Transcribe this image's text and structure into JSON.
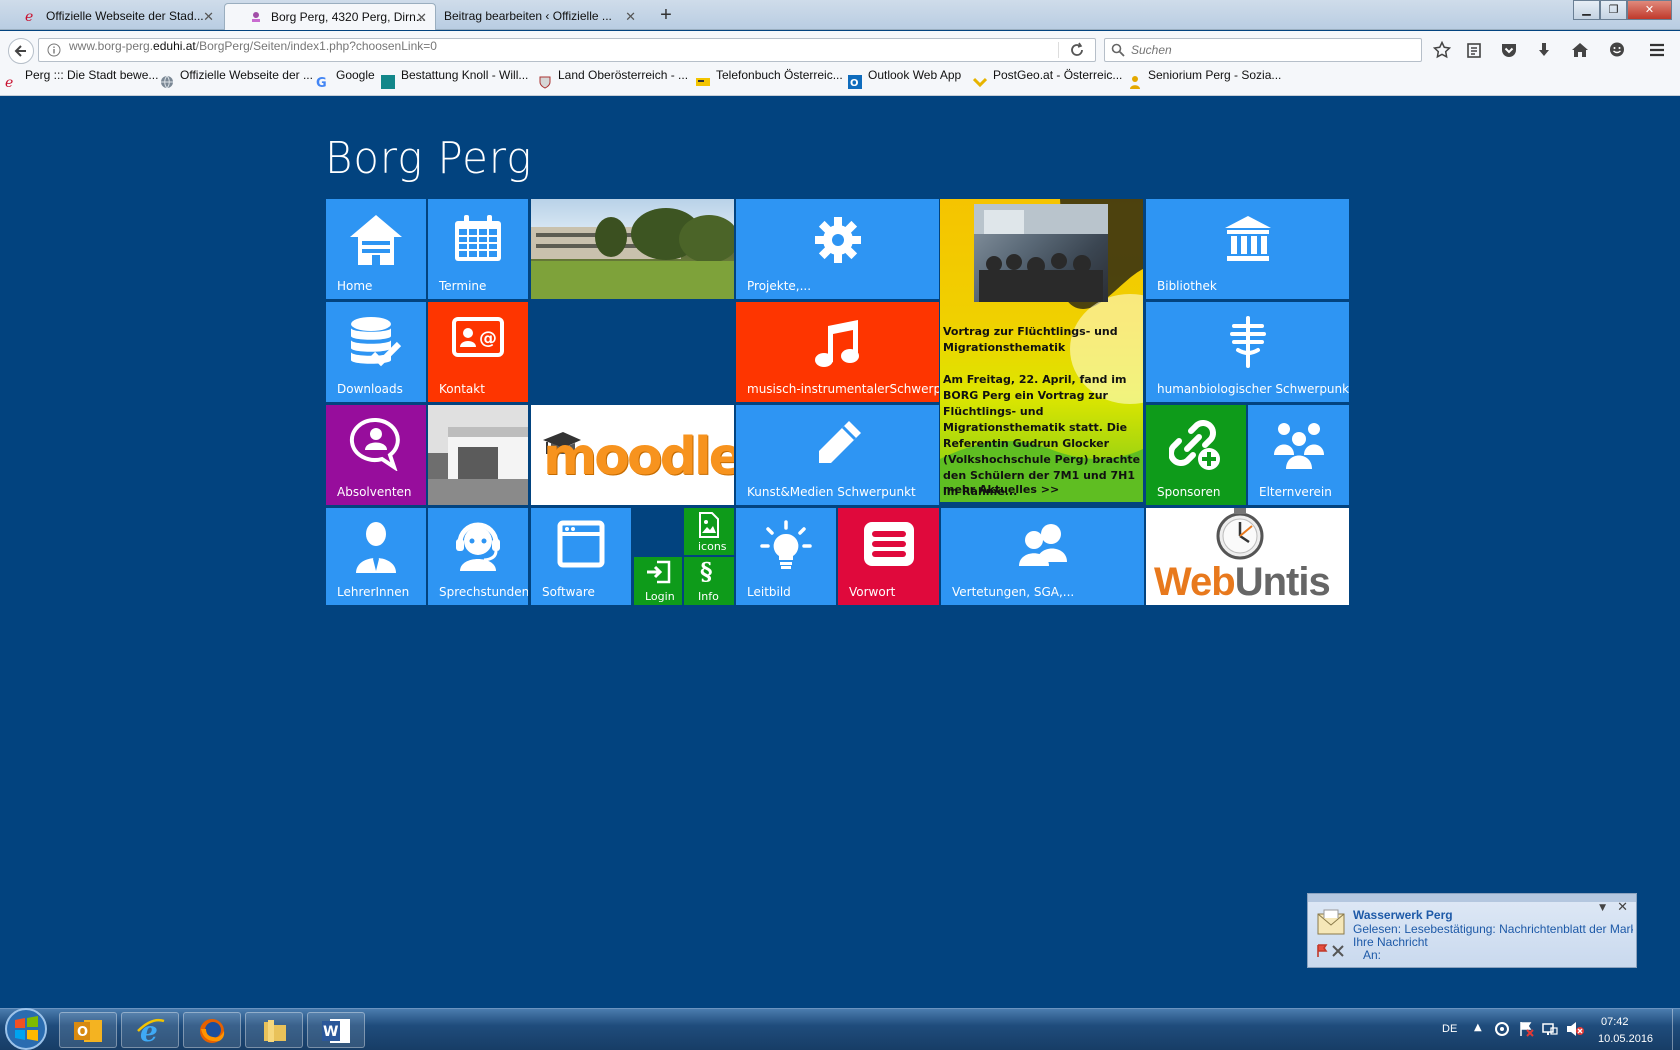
{
  "browser": {
    "tabs": [
      {
        "label": "Offizielle Webseite der Stad...",
        "active": false
      },
      {
        "label": "Borg Perg, 4320 Perg, Dirn...",
        "active": true
      },
      {
        "label": "Beitrag bearbeiten ‹ Offizielle ...",
        "active": false
      }
    ],
    "url_prefix": "www.borg-perg.",
    "url_domain": "eduhi.at",
    "url_path": "/BorgPerg/Seiten/index1.php?choosenLink=0",
    "search_placeholder": "Suchen",
    "bookmarks": [
      "Perg ::: Die Stadt bewe...",
      "Offizielle Webseite der ...",
      "Google",
      "Bestattung Knoll - Will...",
      "Land Oberösterreich - ...",
      "Telefonbuch Österreic...",
      "Outlook Web App",
      "PostGeo.at - Österreic...",
      "Seniorium Perg - Sozia..."
    ]
  },
  "site": {
    "title": "Borg Perg",
    "tiles": {
      "home": "Home",
      "termine": "Termine",
      "projekte": "Projekte,...",
      "bibliothek": "Bibliothek",
      "downloads": "Downloads",
      "kontakt": "Kontakt",
      "musik": "musisch-instrumentalerSchwerpunkt",
      "humanbio": "humanbiologischer Schwerpunkt",
      "absolventen": "Absolventen",
      "moodle": "moodle",
      "kunst": "Kunst&Medien Schwerpunkt",
      "sponsoren": "Sponsoren",
      "elternverein": "Elternverein",
      "lehrer": "LehrerInnen",
      "sprechstunden": "Sprechstunden",
      "software": "Software",
      "icons": "icons",
      "login": "Login",
      "info": "Info",
      "leitbild": "Leitbild",
      "vorwort": "Vorwort",
      "vertretungen": "Vertetungen, SGA,...",
      "webuntis_web": "Web",
      "webuntis_untis": "Untis"
    },
    "news": {
      "title": "Vortrag zur Flüchtlings- und Migrationsthematik",
      "body": "Am Freitag, 22. April, fand im BORG Perg ein Vortrag zur Flüchtlings- und Migrationsthematik statt. Die Referentin Gudrun Glocker (Volkshochschule Perg) brachte den Schülern der 7M1 und 7H1 im Rahme...",
      "more": "mehr Aktuelles >>"
    }
  },
  "notification": {
    "from": "Wasserwerk Perg",
    "subject": "Gelesen: Lesebestätigung: Nachrichtenblatt der Marktg...",
    "message": "Ihre Nachricht",
    "to": "An:"
  },
  "taskbar": {
    "language": "DE",
    "time": "07:42",
    "date": "10.05.2016"
  },
  "colors": {
    "page_bg": "#02437f",
    "tile_blue": "#2e95f3",
    "tile_red": "#fe3500",
    "tile_purple": "#970d9c",
    "tile_green": "#0e9b1a",
    "tile_crimson": "#e0093c",
    "moodle_orange": "#f7931e",
    "webuntis_orange": "#e8791d"
  }
}
